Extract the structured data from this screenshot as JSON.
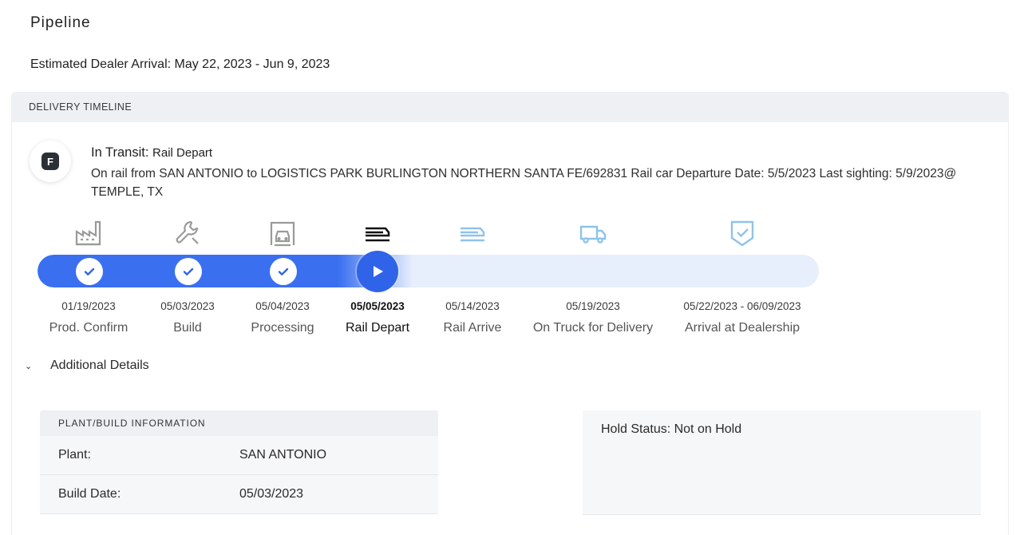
{
  "page": {
    "title": "Pipeline",
    "estimated_arrival": "Estimated Dealer Arrival: May 22, 2023 - Jun 9, 2023"
  },
  "timeline": {
    "header": "DELIVERY TIMELINE",
    "status_badge_letter": "F",
    "status_main": "In Transit:",
    "status_sub": "Rail Depart",
    "status_description": "On rail from SAN ANTONIO to LOGISTICS PARK BURLINGTON NORTHERN SANTA FE/692831 Rail car Departure Date: 5/5/2023 Last sighting: 5/9/2023@ TEMPLE, TX",
    "progress_completed_steps": 3,
    "current_step_index": 3,
    "steps": [
      {
        "date": "01/19/2023",
        "label": "Prod. Confirm",
        "icon": "factory-icon",
        "state": "done"
      },
      {
        "date": "05/03/2023",
        "label": "Build",
        "icon": "wrench-icon",
        "state": "done"
      },
      {
        "date": "05/04/2023",
        "label": "Processing",
        "icon": "car-processing-icon",
        "state": "done"
      },
      {
        "date": "05/05/2023",
        "label": "Rail Depart",
        "icon": "rail-icon",
        "state": "current"
      },
      {
        "date": "05/14/2023",
        "label": "Rail Arrive",
        "icon": "rail-icon",
        "state": "pending"
      },
      {
        "date": "05/19/2023",
        "label": "On Truck for Delivery",
        "icon": "truck-icon",
        "state": "pending"
      },
      {
        "date": "05/22/2023 - 06/09/2023",
        "label": "Arrival at Dealership",
        "icon": "shield-check-icon",
        "state": "pending"
      }
    ],
    "colors": {
      "progress_fill": "#3a6ff0",
      "progress_track": "#e7eefc",
      "done_icon": "#9a9a9a",
      "current_icon": "#111111",
      "pending_icon": "#8ec3ea"
    }
  },
  "details": {
    "toggle_label": "Additional Details",
    "plant_table": {
      "header": "PLANT/BUILD INFORMATION",
      "rows": [
        {
          "key": "Plant:",
          "value": "SAN ANTONIO"
        },
        {
          "key": "Build Date:",
          "value": "05/03/2023"
        }
      ]
    },
    "hold_status": "Hold Status: Not on Hold"
  }
}
